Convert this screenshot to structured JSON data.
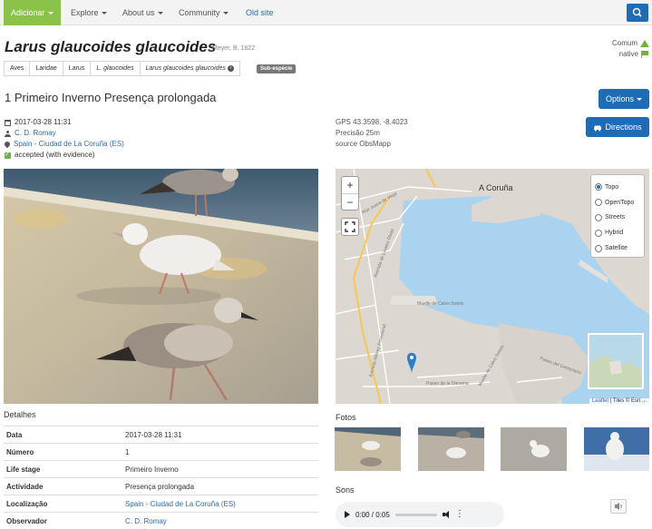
{
  "nav": {
    "add_label": "Adicionar",
    "items": [
      {
        "label": "Explore"
      },
      {
        "label": "About us"
      },
      {
        "label": "Community"
      }
    ],
    "old_site": "Old site"
  },
  "species": {
    "name": "Larus glaucoides glaucoides",
    "author": "Meyer, B, 1822",
    "status": [
      {
        "label": "Comum",
        "icon": "triangle-icon"
      },
      {
        "label": "native",
        "icon": "flag-icon"
      }
    ],
    "breadcrumb": [
      "Aves",
      "Laridae",
      "Larus",
      "L. glaucoides",
      "Larus glaucoides glaucoides"
    ],
    "rank_badge": "Sub-espécie"
  },
  "observation": {
    "heading": "1 Primeiro Inverno Presença prolongada",
    "options_label": "Options",
    "directions_label": "Directions",
    "datetime": "2017-03-28 11:31",
    "observer": "C. D. Romay",
    "location": "Spain - Ciudad de La Coruña (ES)",
    "validation": "accepted (with evidence)",
    "gps": "GPS 43.3598, -8.4023",
    "precision": "Precisão 25m",
    "source": "source ObsMapp"
  },
  "map": {
    "layers": [
      {
        "label": "Topo",
        "selected": true
      },
      {
        "label": "OpenTopo",
        "selected": false
      },
      {
        "label": "Streets",
        "selected": false
      },
      {
        "label": "Hybrid",
        "selected": false
      },
      {
        "label": "Satellite",
        "selected": false
      }
    ],
    "place_label": "A Coruña",
    "attribution_link": "Leaflet",
    "attribution_text": "| Tiles © Esri ..."
  },
  "details": {
    "title": "Detalhes",
    "rows": [
      {
        "key": "Data",
        "value": "2017-03-28 11:31",
        "link": false
      },
      {
        "key": "Número",
        "value": "1",
        "link": false
      },
      {
        "key": "Life stage",
        "value": "Primeiro Inverno",
        "link": false
      },
      {
        "key": "Actividade",
        "value": "Presença prolongada",
        "link": false
      },
      {
        "key": "Localização",
        "value": "Spain - Ciudad de La Coruña (ES)",
        "link": true
      },
      {
        "key": "Observador",
        "value": "C. D. Romay",
        "link": true
      }
    ]
  },
  "fotos": {
    "title": "Fotos",
    "count": 4
  },
  "sons": {
    "title": "Sons",
    "time": "0:00 / 0:05"
  },
  "colors": {
    "brand_green": "#8bc34a",
    "primary_blue": "#1e6cb5",
    "status_green": "#6fb33f",
    "link_blue": "#2a6bb0"
  }
}
